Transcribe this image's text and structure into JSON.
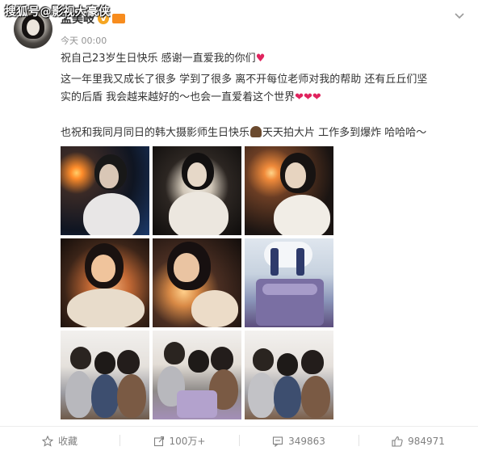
{
  "watermark": "搜狐号@影视大豪侠",
  "post": {
    "username": "孟美岐",
    "verified_badge": "V",
    "timestamp": "今天 00:00",
    "line1": "祝自己23岁生日快乐 感谢一直爱我的你们",
    "line1_heart": "♥",
    "line2": "这一年里我又成长了很多 学到了很多 离不开每位老师对我的帮助 还有丘丘们坚",
    "line3": "实的后盾 我会越来越好的～也会一直爱着这个世界",
    "line3_hearts": "❤❤❤",
    "line4_a": "也祝和我同月同日的韩大摄影师生日快乐",
    "line4_b": "天天拍大片 工作多到爆炸 哈哈哈～"
  },
  "photos": [
    {
      "name": "photo-1"
    },
    {
      "name": "photo-2"
    },
    {
      "name": "photo-3"
    },
    {
      "name": "photo-4"
    },
    {
      "name": "photo-5"
    },
    {
      "name": "photo-6"
    },
    {
      "name": "photo-7"
    },
    {
      "name": "photo-8"
    },
    {
      "name": "photo-9"
    }
  ],
  "actions": {
    "favorite_label": "收藏",
    "repost_count": "100万+",
    "comment_count": "349863",
    "like_count": "984971"
  },
  "icons": {
    "favorite": "star-icon",
    "repost": "share-icon",
    "comment": "comment-icon",
    "like": "thumbs-up-icon",
    "menu": "chevron-down-icon"
  },
  "colors": {
    "text": "#333333",
    "muted": "#808080",
    "heart": "#e0245e",
    "badge": "#f5a623"
  }
}
